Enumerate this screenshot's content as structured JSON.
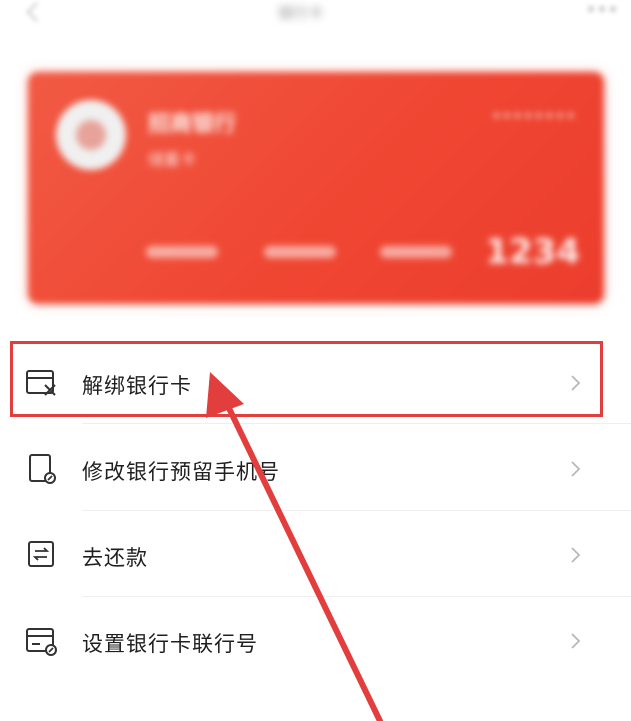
{
  "nav": {
    "back_icon": "back-arrow-icon",
    "title": "银行卡",
    "more_icon": "more-dots-icon"
  },
  "card": {
    "bank_name": "招商银行",
    "card_type": "储蓄卡",
    "right_text": "••••••••",
    "last_four": "1234",
    "background_color": "#ef4632"
  },
  "menu": {
    "items": [
      {
        "label": "解绑银行卡",
        "icon": "unbind-card-icon"
      },
      {
        "label": "修改银行预留手机号",
        "icon": "phone-edit-icon"
      },
      {
        "label": "去还款",
        "icon": "repay-transfer-icon"
      },
      {
        "label": "设置银行卡联行号",
        "icon": "card-settings-icon"
      }
    ]
  },
  "annotation": {
    "highlight_color": "#e23e3e"
  }
}
